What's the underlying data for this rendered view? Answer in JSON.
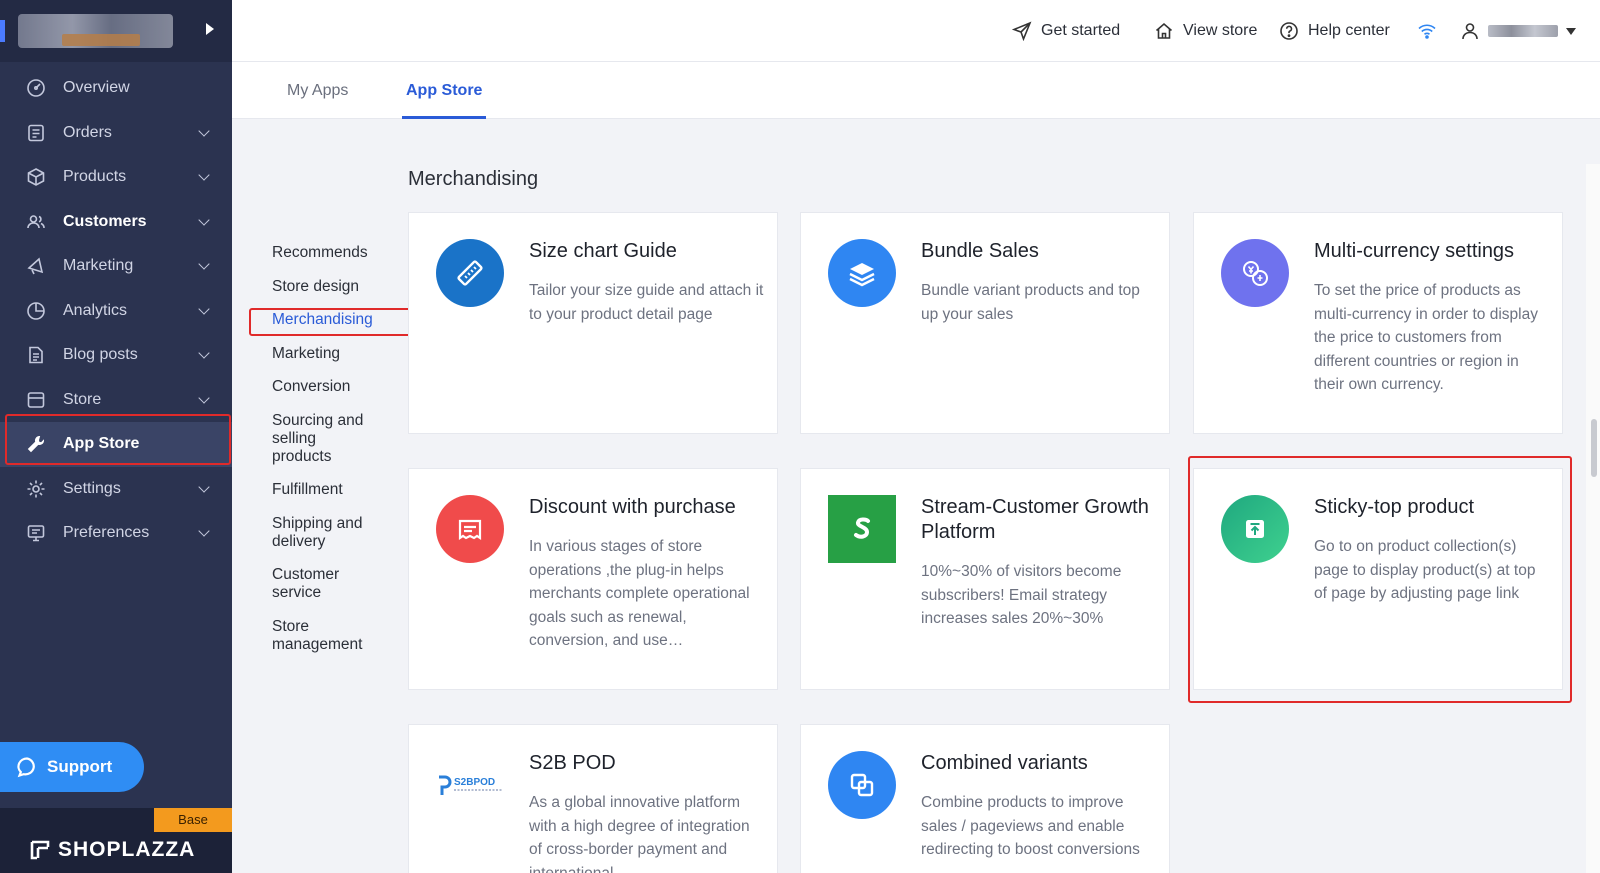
{
  "sidebar": {
    "items": [
      {
        "label": "Overview",
        "icon": "gauge-icon"
      },
      {
        "label": "Orders",
        "icon": "orders-icon"
      },
      {
        "label": "Products",
        "icon": "box-icon"
      },
      {
        "label": "Customers",
        "icon": "users-icon"
      },
      {
        "label": "Marketing",
        "icon": "megaphone-icon"
      },
      {
        "label": "Analytics",
        "icon": "pie-chart-icon"
      },
      {
        "label": "Blog posts",
        "icon": "document-icon"
      },
      {
        "label": "Store",
        "icon": "store-icon"
      },
      {
        "label": "App Store",
        "icon": "wrench-icon"
      },
      {
        "label": "Settings",
        "icon": "gear-icon"
      },
      {
        "label": "Preferences",
        "icon": "monitor-icon"
      }
    ],
    "support_label": "Support",
    "plan_badge": "Base",
    "brand": "SHOPLAZZA"
  },
  "topbar": {
    "get_started": "Get started",
    "view_store": "View store",
    "help_center": "Help center"
  },
  "tabs": {
    "my_apps": "My Apps",
    "app_store": "App Store"
  },
  "categories": [
    "Recommends",
    "Store design",
    "Merchandising",
    "Marketing",
    "Conversion",
    "Sourcing and selling products",
    "Fulfillment",
    "Shipping and delivery",
    "Customer service",
    "Store management"
  ],
  "section_title": "Merchandising",
  "apps": [
    {
      "name": "Size chart Guide",
      "desc": "Tailor your size guide and attach it to your product detail page",
      "icon": "ruler-icon",
      "color": "#1a73c8"
    },
    {
      "name": "Bundle Sales",
      "desc": "Bundle variant products and top up your sales",
      "icon": "layers-icon",
      "color": "#2f86f2"
    },
    {
      "name": "Multi-currency settings",
      "desc": "To set the price of products as multi-currency in order to display the price to customers from different countries or region in their own currency.",
      "icon": "currency-exchange-icon",
      "color": "#6f72ee"
    },
    {
      "name": "Discount with purchase",
      "desc": "In various stages of store operations ,the plug-in helps merchants complete operational goals such as renewal, conversion, and use…",
      "icon": "coupon-icon",
      "color": "#f04b4b"
    },
    {
      "name": "Stream-Customer Growth Platform",
      "desc": "10%~30% of visitors become subscribers! Email strategy increases sales 20%~30%",
      "icon": "stream-logo-icon",
      "color": "#27a045"
    },
    {
      "name": "Sticky-top product",
      "desc": "Go to on product collection(s) page to display product(s) at top of page by adjusting page link",
      "icon": "pin-top-icon",
      "color": "#27b27a"
    },
    {
      "name": "S2B POD",
      "desc": "As a global innovative platform with a high degree of integration of cross-border payment and international",
      "icon": "s2bpod-logo-icon",
      "logo_text": "S2BPOD",
      "color": "#2a7fd9"
    },
    {
      "name": "Combined variants",
      "desc": "Combine products to improve sales / pageviews and enable redirecting to boost conversions",
      "icon": "combine-icon",
      "color": "#2f86f2"
    }
  ]
}
